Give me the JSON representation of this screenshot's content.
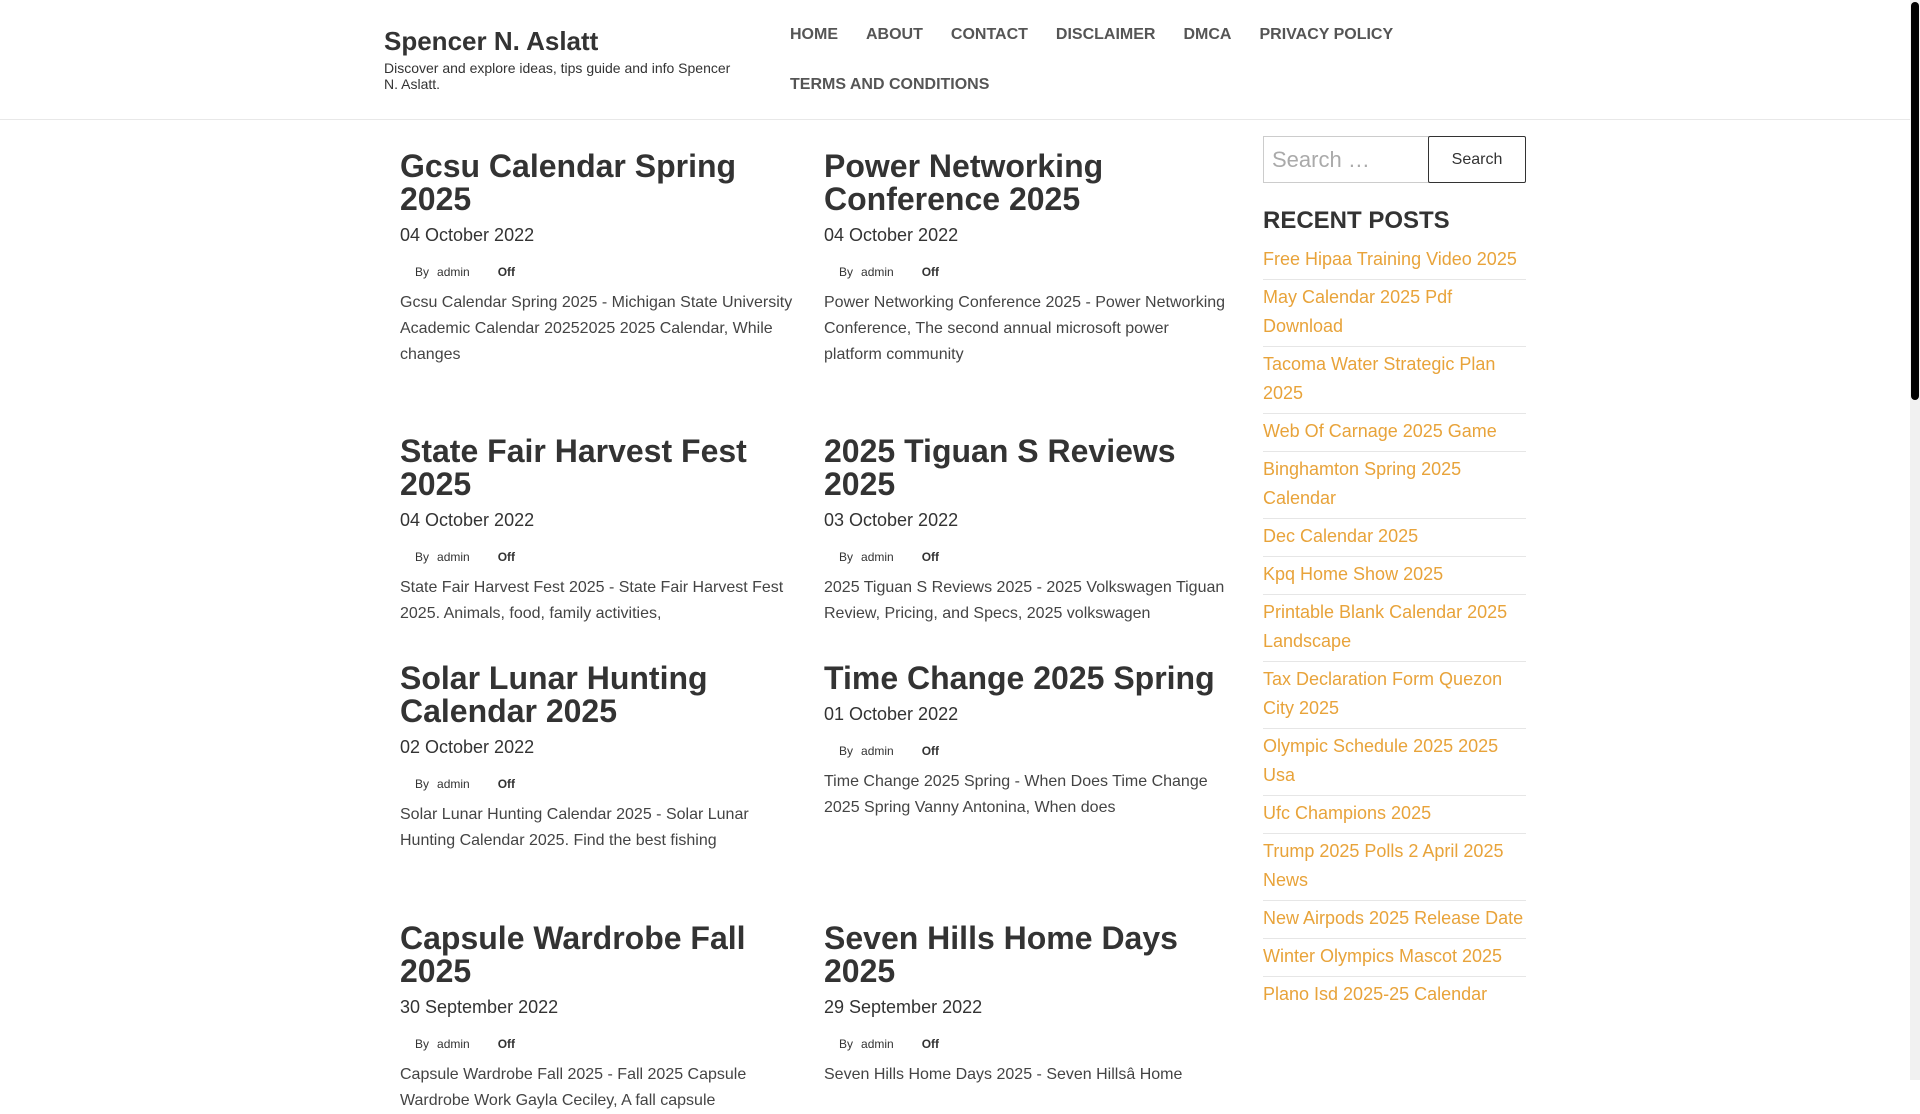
{
  "site": {
    "title": "Spencer N. Aslatt",
    "description": "Discover and explore ideas, tips guide and info Spencer N. Aslatt."
  },
  "nav": [
    "HOME",
    "ABOUT",
    "CONTACT",
    "DISCLAIMER",
    "DMCA",
    "PRIVACY POLICY",
    "TERMS AND CONDITIONS"
  ],
  "meta_labels": {
    "by": "By",
    "comments": "Off"
  },
  "posts": [
    {
      "title": "Gcsu Calendar Spring 2025",
      "date": "04 October 2022",
      "author": "admin",
      "excerpt": "Gcsu Calendar Spring 2025 - Michigan State University Academic Calendar 20252025 2025 Calendar, While changes"
    },
    {
      "title": "Power Networking Conference 2025",
      "date": "04 October 2022",
      "author": "admin",
      "excerpt": "Power Networking Conference 2025 - Power Networking Conference, The second annual microsoft power platform community"
    },
    {
      "title": "State Fair Harvest Fest 2025",
      "date": "04 October 2022",
      "author": "admin",
      "excerpt": "State Fair Harvest Fest 2025 - State Fair Harvest Fest 2025. Animals, food, family activities,"
    },
    {
      "title": "2025 Tiguan S Reviews 2025",
      "date": "03 October 2022",
      "author": "admin",
      "excerpt": "2025 Tiguan S Reviews 2025 - 2025 Volkswagen Tiguan Review, Pricing, and Specs, 2025 volkswagen"
    },
    {
      "title": "Solar Lunar Hunting Calendar 2025",
      "date": "02 October 2022",
      "author": "admin",
      "excerpt": "Solar Lunar Hunting Calendar 2025 - Solar Lunar Hunting Calendar 2025. Find the best fishing"
    },
    {
      "title": "Time Change 2025 Spring",
      "date": "01 October 2022",
      "author": "admin",
      "excerpt": "Time Change 2025 Spring - When Does Time Change 2025 Spring Vanny Antonina, When does"
    },
    {
      "title": "Capsule Wardrobe Fall 2025",
      "date": "30 September 2022",
      "author": "admin",
      "excerpt": "Capsule Wardrobe Fall 2025 - Fall 2025 Capsule Wardrobe Work Gayla Ceciley, A fall capsule"
    },
    {
      "title": "Seven Hills Home Days 2025",
      "date": "29 September 2022",
      "author": "admin",
      "excerpt": "Seven Hills Home Days 2025 - Seven Hillsâ Home"
    }
  ],
  "search": {
    "placeholder": "Search …",
    "button": "Search"
  },
  "recent": {
    "heading": "RECENT POSTS",
    "items": [
      "Free Hipaa Training Video 2025",
      "May Calendar 2025 Pdf Download",
      "Tacoma Water Strategic Plan 2025",
      "Web Of Carnage 2025 Game",
      "Binghamton Spring 2025 Calendar",
      "Dec Calendar 2025",
      "Kpq Home Show 2025",
      "Printable Blank Calendar 2025 Landscape",
      "Tax Declaration Form Quezon City 2025",
      "Olympic Schedule 2025 2025 Usa",
      "Ufc Champions 2025",
      "Trump 2025 Polls 2 April 2025 News",
      "New Airpods 2025 Release Date",
      "Winter Olympics Mascot 2025",
      "Plano Isd 2025-25 Calendar"
    ]
  },
  "colors": {
    "link": "#e8a33a",
    "text": "#333333"
  }
}
